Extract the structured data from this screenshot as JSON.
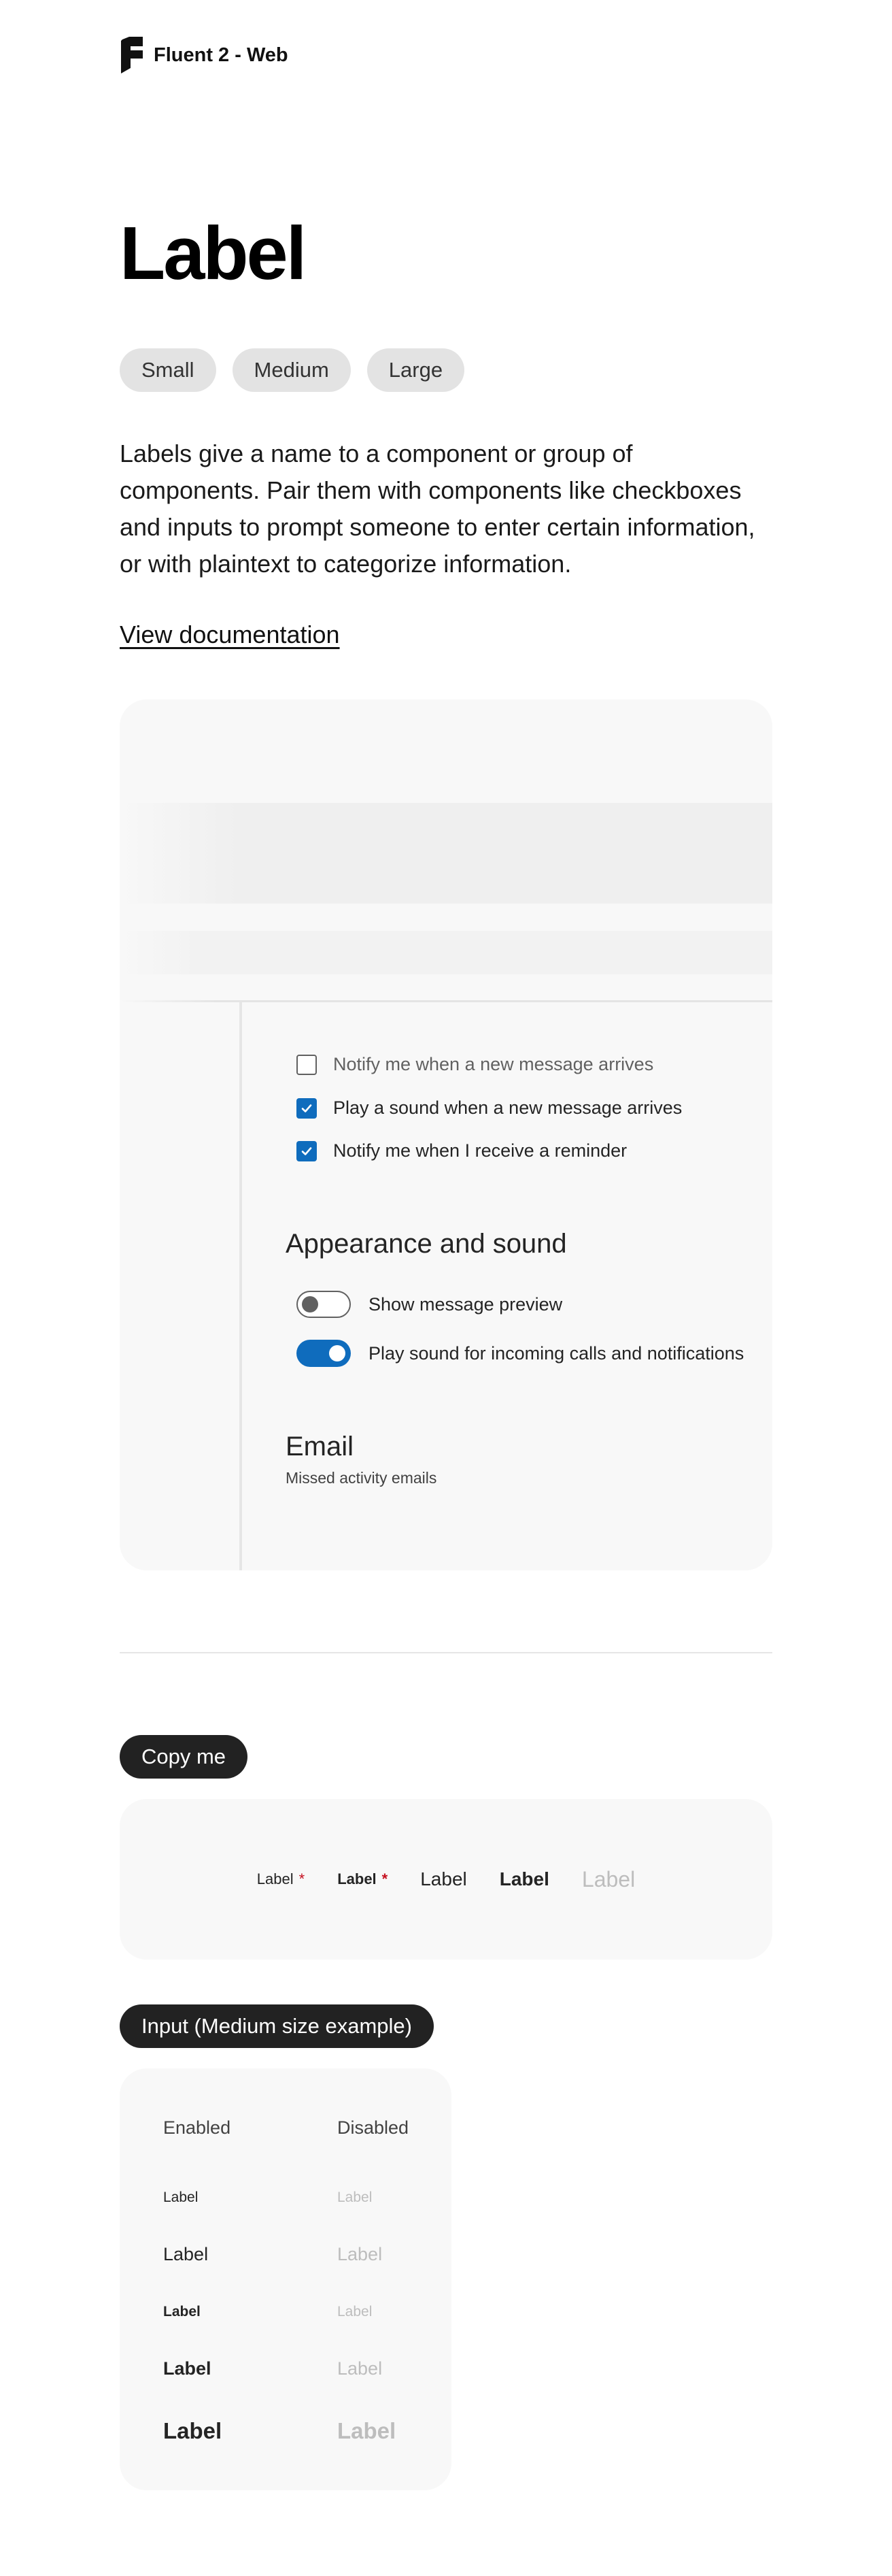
{
  "brand": {
    "name": "Fluent 2 - Web",
    "logo_icon": "fluent-logo-icon"
  },
  "page": {
    "title": "Label",
    "size_pills": [
      "Small",
      "Medium",
      "Large"
    ],
    "description": "Labels give a name to a component or group of components. Pair them with components like checkboxes and inputs to prompt someone to enter certain information, or with plaintext to categorize information.",
    "doc_link": "View documentation"
  },
  "hero": {
    "checkboxes": [
      {
        "label": "Notify me when a new message arrives",
        "checked": false
      },
      {
        "label": "Play a sound when a new message arrives",
        "checked": true
      },
      {
        "label": "Notify me when I receive a reminder",
        "checked": true
      }
    ],
    "appearance_title": "Appearance and sound",
    "toggles": [
      {
        "label": "Show message preview",
        "on": false
      },
      {
        "label": "Play sound for incoming calls and notifications",
        "on": true
      }
    ],
    "email_title": "Email",
    "email_subtitle": "Missed activity emails",
    "accent_color": "#0f6cbd"
  },
  "copy_section": {
    "tag": "Copy me",
    "labels": [
      {
        "text": "Label",
        "required_mark": "*"
      },
      {
        "text": "Label",
        "required_mark": "*"
      },
      {
        "text": "Label"
      },
      {
        "text": "Label"
      },
      {
        "text": "Label"
      }
    ]
  },
  "input_section": {
    "tag": "Input (Medium size example)",
    "enabled_header": "Enabled",
    "disabled_header": "Disabled",
    "rows": [
      {
        "enabled": "Label",
        "disabled": "Label"
      },
      {
        "enabled": "Label",
        "disabled": "Label"
      },
      {
        "enabled": "Label",
        "disabled": "Label"
      },
      {
        "enabled": "Label",
        "disabled": "Label"
      },
      {
        "enabled": "Label",
        "disabled": "Label"
      }
    ]
  },
  "colors": {
    "required": "#c50f1f",
    "tag_bg": "#222222",
    "pill_bg": "#e3e3e3"
  }
}
